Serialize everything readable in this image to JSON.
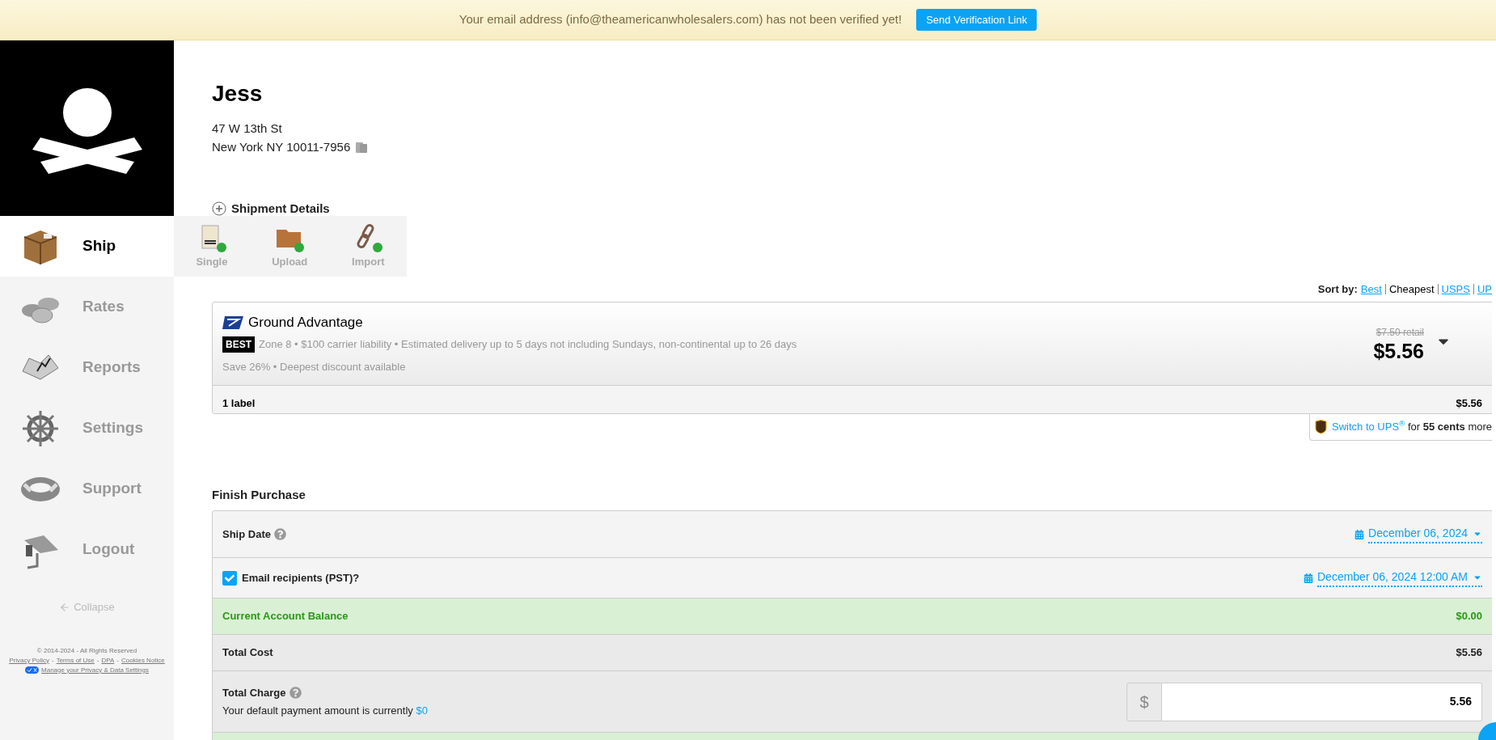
{
  "banner": {
    "message": "Your email address (info@theamericanwholesalers.com) has not been verified yet!",
    "button": "Send Verification Link"
  },
  "sidebar": {
    "items": [
      {
        "kind": "box",
        "label": "Ship",
        "selected": true
      },
      {
        "kind": "coins",
        "label": "Rates",
        "selected": false
      },
      {
        "kind": "book",
        "label": "Reports",
        "selected": false
      },
      {
        "kind": "wheel",
        "label": "Settings",
        "selected": false
      },
      {
        "kind": "ring",
        "label": "Support",
        "selected": false
      },
      {
        "kind": "plank",
        "label": "Logout",
        "selected": false
      }
    ],
    "collapse": "Collapse",
    "copyright": "© 2014-2024 - All Rights Reserved",
    "links": [
      "Privacy Policy",
      "Terms of Use",
      "DPA",
      "Cookies Notice"
    ],
    "link_separator": "-",
    "privacy_settings": "Manage your Privacy & Data Settings"
  },
  "ship_menu": [
    {
      "kind": "label",
      "label": "Single"
    },
    {
      "kind": "folder",
      "label": "Upload"
    },
    {
      "kind": "chain",
      "label": "Import"
    }
  ],
  "recipient": {
    "name": "Jess",
    "address_line_1": "47 W 13th St",
    "address_line_2": "New York NY 10011-7956"
  },
  "shipment_details": "Shipment Details",
  "sort": {
    "label": "Sort by:",
    "options": [
      {
        "label": "Best",
        "selected": false
      },
      {
        "label": "Cheapest",
        "selected": true
      },
      {
        "label": "USPS",
        "selected": false
      },
      {
        "label": "UP",
        "selected": false
      }
    ]
  },
  "service": {
    "name": "Ground Advantage",
    "badge": "BEST",
    "details": "Zone 8 • $100 carrier liability • Estimated delivery up to 5 days not including Sundays, non-continental up to 26 days",
    "savings": "Save 26% • Deepest discount available",
    "retail": "$7.50 retail",
    "price": "$5.56",
    "label_count": "1 label",
    "label_total": "$5.56"
  },
  "ups_offer": {
    "link": "Switch to UPS$^{®}$",
    "text": "for **55 cents** more"
  },
  "finish": {
    "title": "Finish Purchase",
    "rows": [
      {
        "kind": "date",
        "label": "Ship Date",
        "help": true,
        "value": "December 06, 2024"
      },
      {
        "kind": "checkbox",
        "label": "Email recipients (PST)?",
        "checked": true,
        "value": "December 06, 2024 12:00 AM"
      },
      {
        "kind": "balance",
        "label": "Current Account Balance",
        "value": "$0.00"
      },
      {
        "kind": "total",
        "label": "Total Cost",
        "value": "$5.56"
      },
      {
        "kind": "charge",
        "label": "Total Charge",
        "help": true,
        "note": "Your default payment amount is currently",
        "note_link": "$0",
        "prefix": "$",
        "value": "5.56"
      },
      {
        "kind": "balance_cut"
      }
    ]
  }
}
